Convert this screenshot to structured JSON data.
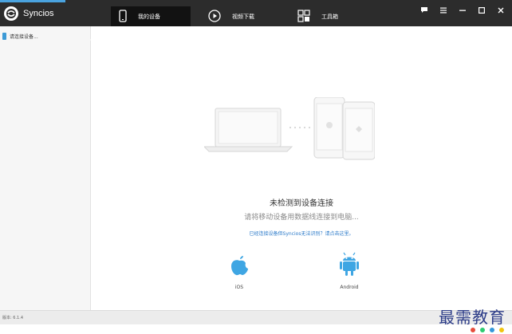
{
  "app": {
    "title": "Syncios",
    "accent_color": "#4aa3df"
  },
  "tabs": [
    {
      "label": "我的设备",
      "icon": "phone-icon",
      "active": true
    },
    {
      "label": "视频下载",
      "icon": "play-icon",
      "active": false
    },
    {
      "label": "工具箱",
      "icon": "toolbox-icon",
      "active": false
    }
  ],
  "window_controls": {
    "icons": [
      "feedback-icon",
      "menu-icon",
      "minimize-icon",
      "maximize-icon",
      "close-icon"
    ]
  },
  "sidebar": {
    "items": [
      {
        "label": "请连接设备..."
      }
    ]
  },
  "main": {
    "title": "未检测到设备连接",
    "subtitle": "请将移动设备用数据线连接到电脑...",
    "help_link": "已经连接设备但Syncios无法识别？请点击这里。",
    "platforms": [
      {
        "name": "iOS",
        "icon": "apple-icon",
        "color": "#3fa6e3"
      },
      {
        "name": "Android",
        "icon": "android-icon",
        "color": "#3fa6e3"
      }
    ]
  },
  "status": {
    "version": "版本: 6.1.4"
  },
  "watermark": {
    "text": "最需教育"
  }
}
